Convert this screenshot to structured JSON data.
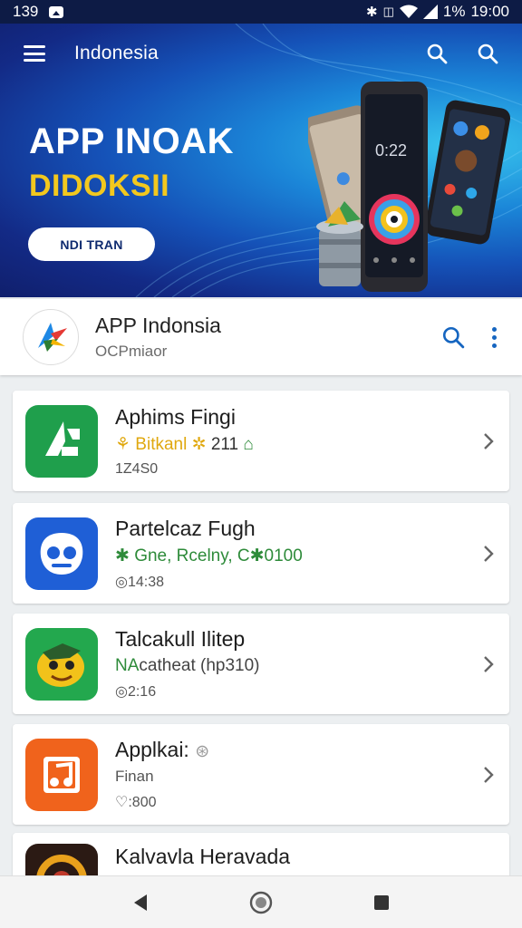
{
  "status_bar": {
    "left_text": "139",
    "battery": "1%",
    "time": "19:00"
  },
  "top_bar": {
    "title": "Indonesia"
  },
  "hero": {
    "headline": "APP INOAK",
    "subheadline": "DIDOKSII",
    "button_label": "NDI TRAN"
  },
  "app_header": {
    "name": "APP Indonsia",
    "subtitle": "OCPmiaor"
  },
  "apps": [
    {
      "name": "Aphims Fingi",
      "meta_parts": [
        "⚘ Bitkanl ✲",
        " 211 ",
        "⌂"
      ],
      "meta_colors": [
        "#e0a80f",
        "#333333",
        "#2e8b3a"
      ],
      "extra": "1Z4S0"
    },
    {
      "name": "Partelcaz Fugh",
      "meta_parts": [
        "✱ Gne, Rcelny, C✱",
        "0100"
      ],
      "meta_colors": [
        "#2e8b3a",
        "#2e8b3a"
      ],
      "extra": "◎14:38"
    },
    {
      "name": "Talcakull Ilitep",
      "meta_parts": [
        "NA",
        "catheat (hp310)"
      ],
      "meta_colors": [
        "#2e8b3a",
        "#444444"
      ],
      "extra": "◎2:16"
    },
    {
      "name": "Applkai:",
      "name_icon": "⊛",
      "meta_parts": [
        "Finan"
      ],
      "meta_colors": [
        "#555555"
      ],
      "extra": "♡:800"
    },
    {
      "name": "Kalvavla Heravada",
      "meta_parts": [],
      "meta_colors": [],
      "extra": ""
    }
  ],
  "icons": {
    "menu": "hamburger-icon",
    "search": "search-icon",
    "more": "kebab-icon",
    "chevron": "chevron-right-icon",
    "back": "back-triangle-icon",
    "home": "home-circle-icon",
    "recents": "recents-square-icon"
  },
  "colors": {
    "hero_dark": "#101f6c",
    "hero_light": "#38c6ee",
    "accent_yellow": "#f2c81e",
    "link_blue": "#1565c0",
    "green": "#2e8b3a"
  }
}
